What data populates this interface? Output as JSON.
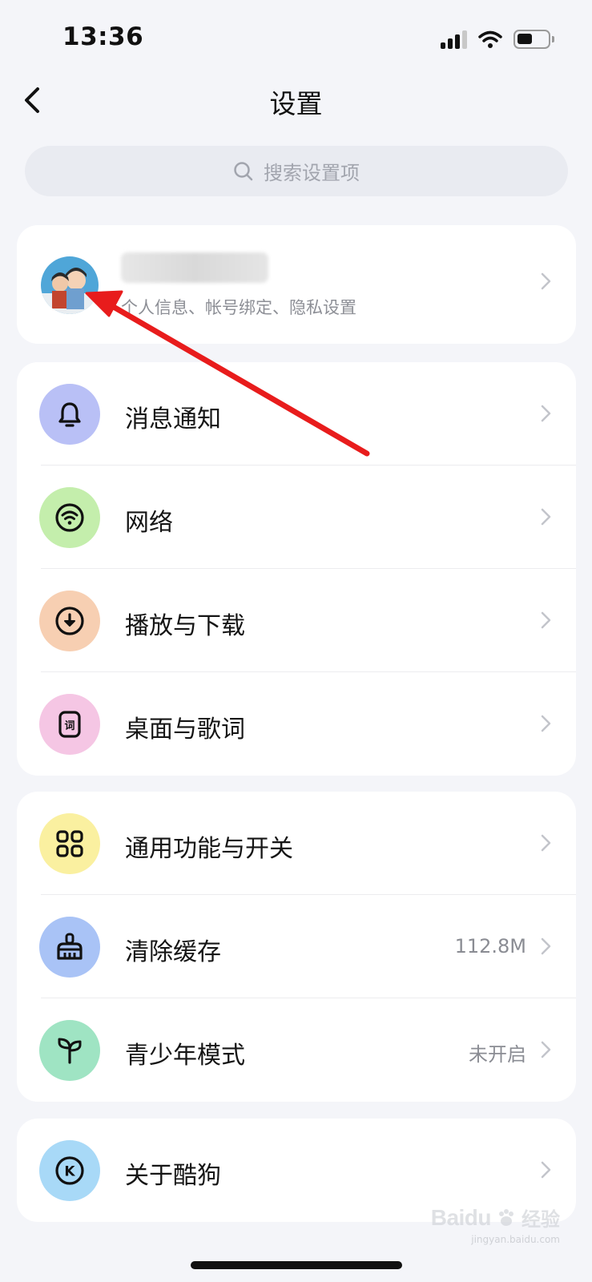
{
  "status_bar": {
    "time": "13:36"
  },
  "nav": {
    "title": "设置"
  },
  "search": {
    "placeholder": "搜索设置项"
  },
  "profile": {
    "subtitle": "个人信息、帐号绑定、隐私设置"
  },
  "groups": [
    {
      "items": [
        {
          "label": "消息通知",
          "icon": "bell-icon",
          "color": "#b9c0f6"
        },
        {
          "label": "网络",
          "icon": "wifi-icon",
          "color": "#c4eeac"
        },
        {
          "label": "播放与下载",
          "icon": "download-icon",
          "color": "#f7cfb2"
        },
        {
          "label": "桌面与歌词",
          "icon": "lyrics-icon",
          "color": "#f5c6e4"
        }
      ]
    },
    {
      "items": [
        {
          "label": "通用功能与开关",
          "icon": "grid-icon",
          "color": "#faf0a0"
        },
        {
          "label": "清除缓存",
          "icon": "broom-icon",
          "color": "#a9c3f6",
          "value": "112.8M"
        },
        {
          "label": "青少年模式",
          "icon": "sprout-icon",
          "color": "#9fe4c3",
          "value": "未开启"
        }
      ]
    },
    {
      "items": [
        {
          "label": "关于酷狗",
          "icon": "kugou-logo-icon",
          "color": "#a8d9f7"
        }
      ]
    }
  ],
  "annotation": {
    "arrow_color": "#e81c1c"
  },
  "watermark": {
    "brand": "Baidu",
    "brand_cn": "经验",
    "url": "jingyan.baidu.com"
  }
}
